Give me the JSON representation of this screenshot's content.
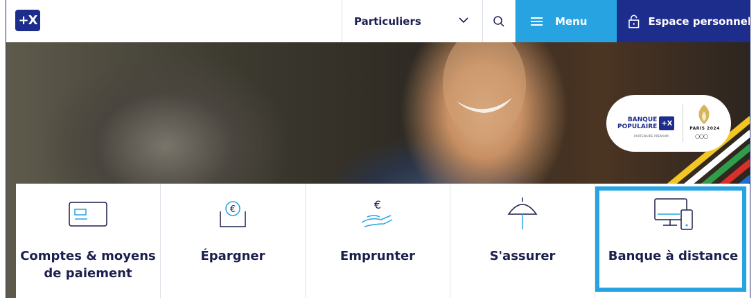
{
  "header": {
    "logo_text": "+X",
    "segment_label": "Particuliers",
    "menu_label": "Menu",
    "espace_label": "Espace personnel"
  },
  "badge": {
    "bp_line1": "BANQUE",
    "bp_line2": "POPULAIRE",
    "bp_logo": "+X",
    "bp_sub": "PARTENAIRE PREMIUM",
    "paris_text": "PARIS 2024"
  },
  "tiles": [
    {
      "label": "Comptes & moyens de paiement",
      "icon": "card-icon"
    },
    {
      "label": "Épargner",
      "icon": "piggy-coin-icon"
    },
    {
      "label": "Emprunter",
      "icon": "hand-euro-icon"
    },
    {
      "label": "S'assurer",
      "icon": "umbrella-icon"
    },
    {
      "label": "Banque à distance",
      "icon": "devices-icon"
    }
  ],
  "colors": {
    "brand_blue": "#1d2d8c",
    "accent_blue": "#27a3e2",
    "text_dark": "#1a1f4d"
  }
}
